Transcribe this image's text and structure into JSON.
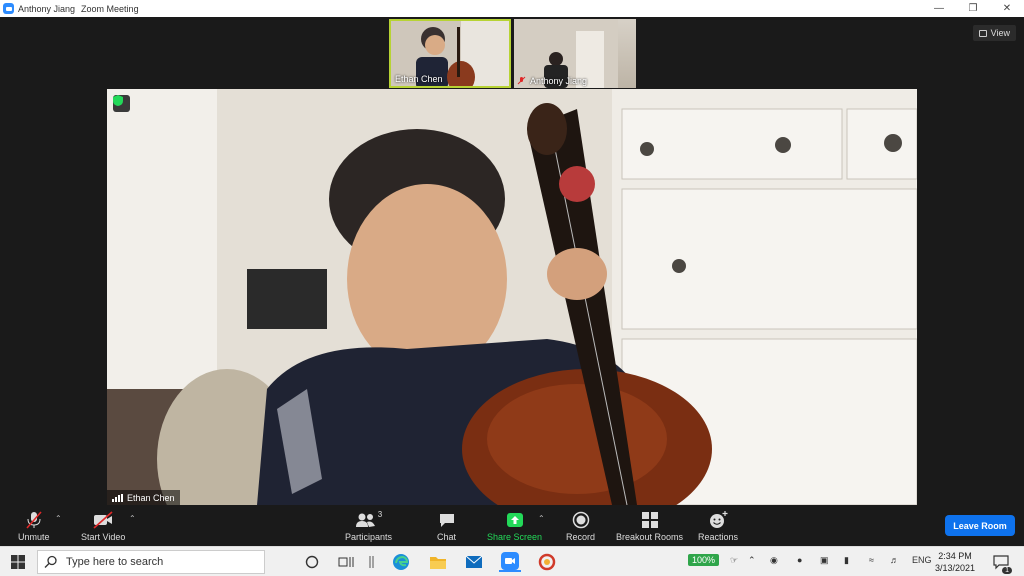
{
  "window": {
    "user": "Anthony Jiang",
    "app_title": "Zoom Meeting"
  },
  "view_button": {
    "label": "View"
  },
  "thumbnails": [
    {
      "name": "Ethan Chen"
    },
    {
      "name": "Anthony Jiang"
    }
  ],
  "main_video": {
    "speaker_name": "Ethan Chen"
  },
  "toolbar": {
    "unmute": "Unmute",
    "start_video": "Start Video",
    "participants": "Participants",
    "participants_count": "3",
    "chat": "Chat",
    "share_screen": "Share Screen",
    "record": "Record",
    "breakout_rooms": "Breakout Rooms",
    "reactions": "Reactions",
    "leave_room": "Leave Room"
  },
  "taskbar": {
    "search_placeholder": "Type here to search",
    "battery": "100%",
    "language": "ENG",
    "time": "2:34 PM",
    "date": "3/13/2021",
    "notifications_count": "1"
  },
  "colors": {
    "accent_blue": "#0e72ed",
    "share_green": "#23d959",
    "active_border": "#b7d334",
    "muted_red": "#e02828"
  }
}
